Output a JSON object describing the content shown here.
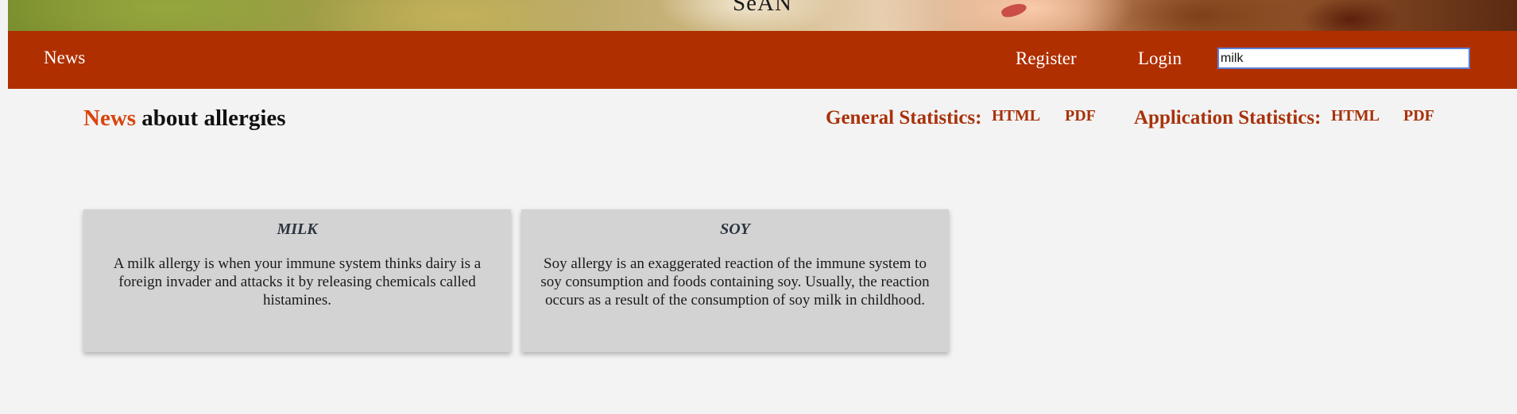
{
  "banner": {
    "site_name": "SeAN"
  },
  "nav": {
    "news_label": "News",
    "register_label": "Register",
    "login_label": "Login",
    "search_value": "milk"
  },
  "heading": {
    "accent": "News",
    "rest": " about allergies"
  },
  "stats": {
    "general_label": "General Statistics:",
    "general_html": "HTML",
    "general_pdf": "PDF",
    "application_label": "Application Statistics:",
    "application_html": "HTML",
    "application_pdf": "PDF"
  },
  "cards": [
    {
      "title": "MILK",
      "description": "A milk allergy is when your immune system thinks dairy is a foreign invader and attacks it by releasing chemicals called histamines."
    },
    {
      "title": "SOY",
      "description": "Soy allergy is an exaggerated reaction of the immune system to soy consumption and foods containing soy. Usually, the reaction occurs as a result of the consumption of soy milk in childhood."
    }
  ],
  "colors": {
    "navbar": "#b02f00",
    "accent": "#d9440e",
    "stat_text": "#a8320b",
    "card_bg": "#d3d3d3",
    "page_bg": "#f3f3f3"
  }
}
